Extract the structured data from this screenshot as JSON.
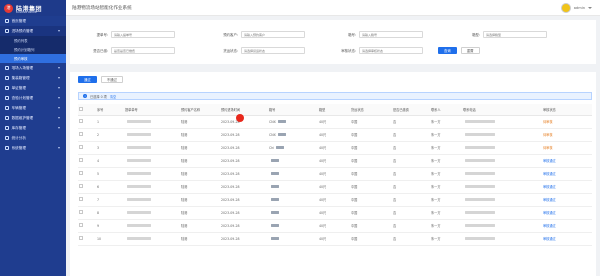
{
  "header": {
    "logo_symbol": "港",
    "logo_text": "陆港集团",
    "logo_sub": "LUGANG GROUP",
    "title": "陆港物流场站智能化作业系统",
    "user_name": "admin"
  },
  "sidebar": {
    "items": [
      {
        "label": "首页管理",
        "expanded": false
      },
      {
        "label": "进场预约管理",
        "expanded": true
      },
      {
        "label": "堆场入场管理",
        "expanded": false
      },
      {
        "label": "集装箱管理",
        "expanded": false
      },
      {
        "label": "单证管理",
        "expanded": false
      },
      {
        "label": "查验计划管理",
        "expanded": false
      },
      {
        "label": "车辆管理",
        "expanded": false
      },
      {
        "label": "数据维护管理",
        "expanded": false
      },
      {
        "label": "库存管理",
        "expanded": false
      },
      {
        "label": "统计分析",
        "expanded": false
      },
      {
        "label": "系统管理",
        "expanded": false
      }
    ],
    "subitems": [
      {
        "label": "预约列表",
        "active": false
      },
      {
        "label": "预约计划箱列",
        "active": false
      },
      {
        "label": "预约审核",
        "active": true
      }
    ]
  },
  "filters": {
    "row1": [
      {
        "label": "提单号:",
        "placeholder": "请输入提单号"
      },
      {
        "label": "预约客户:",
        "placeholder": "请输入预约客户"
      },
      {
        "label": "箱号:",
        "placeholder": "请输入箱号"
      },
      {
        "label": "箱型:",
        "placeholder": "请选择箱型"
      }
    ],
    "row2": [
      {
        "label": "是否已缴:",
        "placeholder": "是否是否已缴费"
      },
      {
        "label": "货运状态:",
        "placeholder": "请选择货运状态"
      },
      {
        "label": "审核状态:",
        "placeholder": "请选择审核状态"
      }
    ],
    "search_label": "查询",
    "reset_label": "重置"
  },
  "toolbar": {
    "approve_label": "通过",
    "reject_label": "不通过"
  },
  "selection": {
    "info_glyph": "i",
    "text": "已选择 0 项",
    "clear_label": "清空"
  },
  "table": {
    "columns": [
      "序号",
      "提单单号",
      "预约客户名称",
      "预约进场时间",
      "箱号",
      "箱型",
      "货运状态",
      "是否已缴费",
      "联系人",
      "联系电话",
      "审核状态"
    ],
    "rows": [
      {
        "no": "1",
        "customer": "陆港",
        "date": "2023-09-28",
        "box": "CNX",
        "type": "40尺",
        "state": "中国",
        "paid": "否",
        "contact": "朱一方",
        "status": "待审核",
        "status_color": "orange"
      },
      {
        "no": "2",
        "customer": "陆港",
        "date": "2023-09-28",
        "box": "CNX",
        "type": "40尺",
        "state": "中国",
        "paid": "否",
        "contact": "朱一方",
        "status": "待审核",
        "status_color": "orange"
      },
      {
        "no": "3",
        "customer": "陆港",
        "date": "2023-09-28",
        "box": "Chi",
        "type": "40尺",
        "state": "中国",
        "paid": "否",
        "contact": "朱一方",
        "status": "待审核",
        "status_color": "orange"
      },
      {
        "no": "4",
        "customer": "陆港",
        "date": "2023-09-28",
        "box": "",
        "type": "40尺",
        "state": "中国",
        "paid": "否",
        "contact": "朱一方",
        "status": "审核通过",
        "status_color": "blue"
      },
      {
        "no": "5",
        "customer": "陆港",
        "date": "2023-09-28",
        "box": "",
        "type": "40尺",
        "state": "中国",
        "paid": "否",
        "contact": "朱一方",
        "status": "审核通过",
        "status_color": "blue"
      },
      {
        "no": "6",
        "customer": "陆港",
        "date": "2023-09-28",
        "box": "",
        "type": "40尺",
        "state": "中国",
        "paid": "否",
        "contact": "朱一方",
        "status": "审核通过",
        "status_color": "blue"
      },
      {
        "no": "7",
        "customer": "陆港",
        "date": "2023-09-28",
        "box": "",
        "type": "40尺",
        "state": "中国",
        "paid": "否",
        "contact": "朱一方",
        "status": "审核通过",
        "status_color": "blue"
      },
      {
        "no": "8",
        "customer": "陆港",
        "date": "2023-09-28",
        "box": "",
        "type": "40尺",
        "state": "中国",
        "paid": "否",
        "contact": "朱一方",
        "status": "审核通过",
        "status_color": "blue"
      },
      {
        "no": "9",
        "customer": "陆港",
        "date": "2023-09-28",
        "box": "",
        "type": "40尺",
        "state": "中国",
        "paid": "否",
        "contact": "朱一方",
        "status": "审核通过",
        "status_color": "blue"
      },
      {
        "no": "10",
        "customer": "陆港",
        "date": "2023-09-28",
        "box": "",
        "type": "40尺",
        "state": "中国",
        "paid": "否",
        "contact": "朱一方",
        "status": "审核通过",
        "status_color": "blue"
      }
    ]
  },
  "colors": {
    "sidebar": "#1f3d8f",
    "primary": "#1f6feb",
    "pending": "#e67e22",
    "marker": "#e8281c"
  }
}
